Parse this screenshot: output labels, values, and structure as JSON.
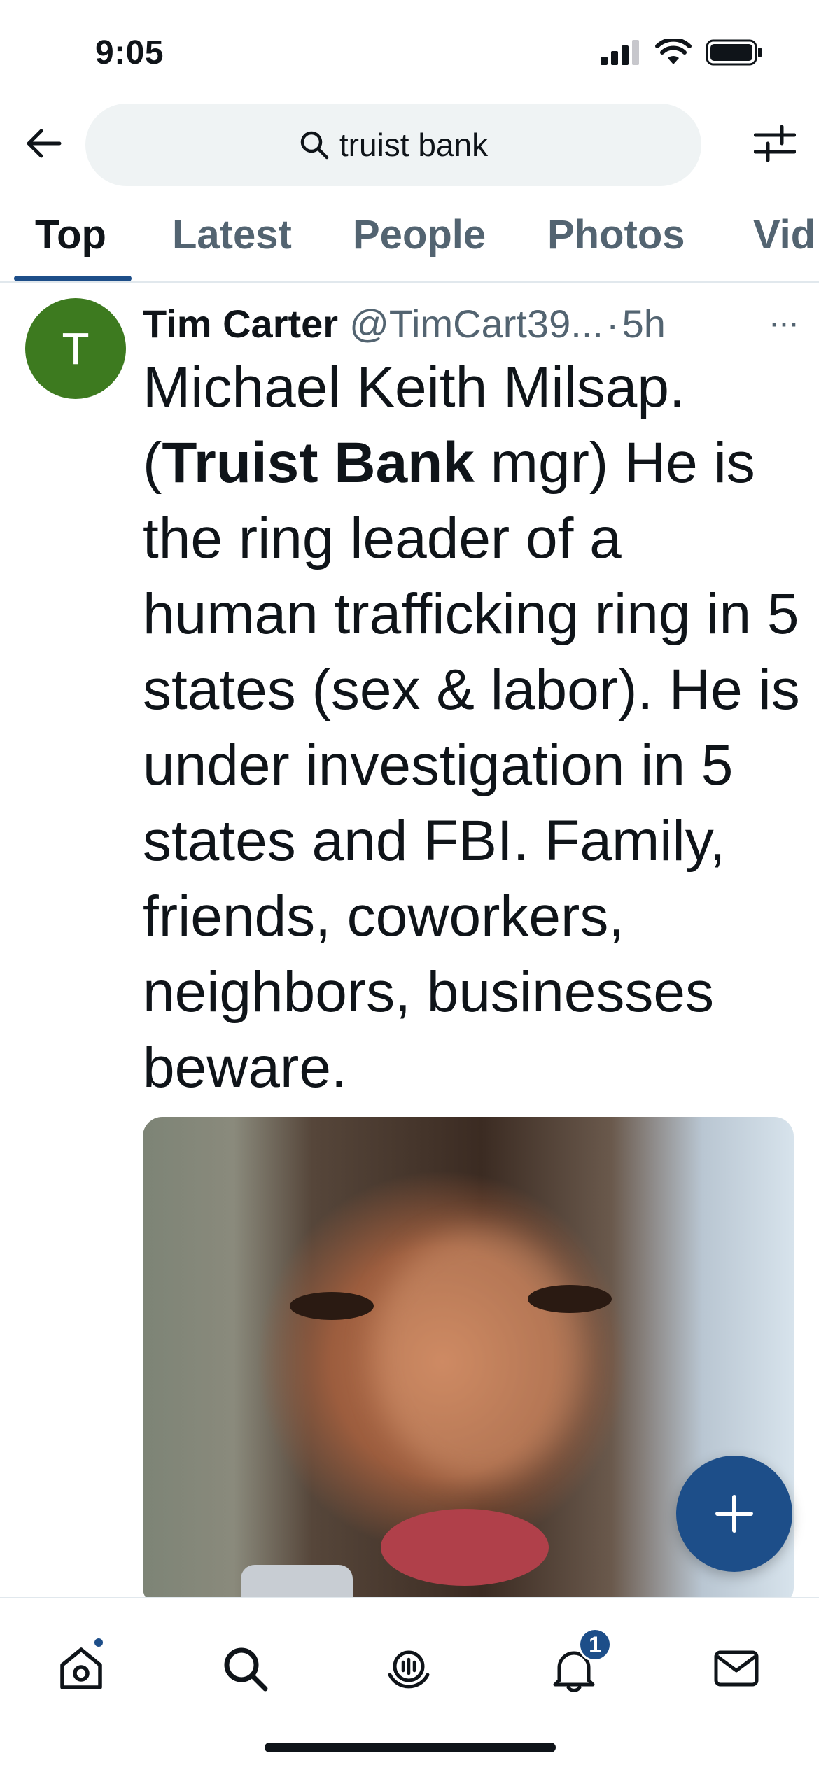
{
  "status_bar": {
    "time": "9:05",
    "icons": [
      "cellular-signal-icon",
      "wifi-icon",
      "battery-icon"
    ]
  },
  "search": {
    "query": "truist bank"
  },
  "tabs": [
    {
      "label": "Top",
      "active": true
    },
    {
      "label": "Latest",
      "active": false
    },
    {
      "label": "People",
      "active": false
    },
    {
      "label": "Photos",
      "active": false
    },
    {
      "label": "Vid",
      "active": false
    }
  ],
  "tweet": {
    "avatar_letter": "T",
    "avatar_color": "#3d7a1f",
    "author_name": "Tim Carter",
    "author_handle": "@TimCart39...",
    "separator": "·",
    "time": "5h",
    "more": "···",
    "text_before": "Michael Keith Milsap. (",
    "text_bold": "Truist Bank",
    "text_after": " mgr) He is the ring leader of a human trafficking ring in 5 states (sex & labor). He is under investigation in 5 states and FBI. Family, friends, coworkers, neighbors, businesses beware."
  },
  "fab": {
    "icon": "plus-icon"
  },
  "bottom_nav": {
    "items": [
      "home-icon",
      "search-icon",
      "spaces-icon",
      "notifications-icon",
      "messages-icon"
    ],
    "notification_count": "1"
  },
  "colors": {
    "accent": "#1d4e89",
    "text": "#0f1419",
    "secondary_text": "#536471",
    "search_bg": "#eff3f4"
  }
}
